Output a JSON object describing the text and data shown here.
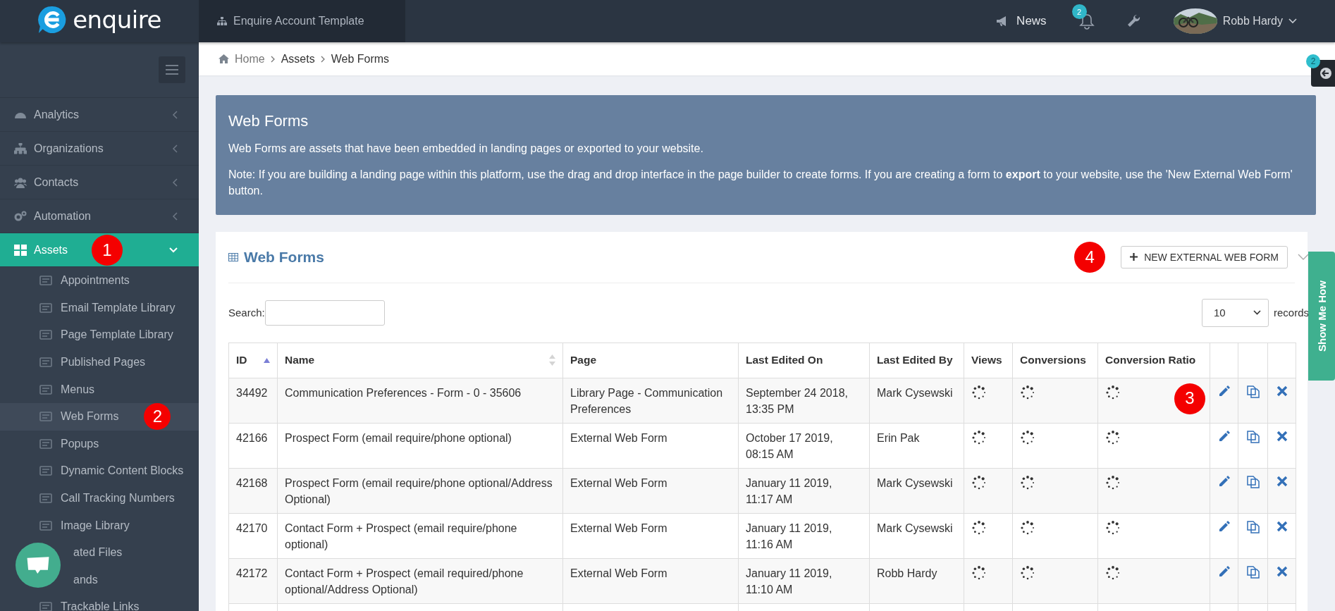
{
  "header": {
    "logo_text": "enquire",
    "account": "Enquire Account Template",
    "news": "News",
    "notifications_count": "2",
    "user": "Robb Hardy"
  },
  "breadcrumb": [
    "Home",
    "Assets",
    "Web Forms"
  ],
  "sidebar": {
    "items": [
      {
        "label": "Analytics",
        "expanded": false,
        "selected": false
      },
      {
        "label": "Organizations",
        "expanded": false,
        "selected": false
      },
      {
        "label": "Contacts",
        "expanded": false,
        "selected": false
      },
      {
        "label": "Automation",
        "expanded": false,
        "selected": false
      },
      {
        "label": "Assets",
        "expanded": true,
        "selected": true,
        "children": [
          {
            "label": "Appointments",
            "selected": false
          },
          {
            "label": "Email Template Library",
            "selected": false
          },
          {
            "label": "Page Template Library",
            "selected": false
          },
          {
            "label": "Published Pages",
            "selected": false
          },
          {
            "label": "Menus",
            "selected": false
          },
          {
            "label": "Web Forms",
            "selected": true
          },
          {
            "label": "Popups",
            "selected": false
          },
          {
            "label": "Dynamic Content Blocks",
            "selected": false
          },
          {
            "label": "Call Tracking Numbers",
            "selected": false
          },
          {
            "label": "Image Library",
            "selected": false
          },
          {
            "label": "ated Files",
            "selected": false
          },
          {
            "label": "ands",
            "selected": false
          },
          {
            "label": "Trackable Links",
            "selected": false
          }
        ]
      }
    ]
  },
  "info": {
    "title": "Web Forms",
    "text": "Web Forms are assets that have been embedded in landing pages or exported to your website.",
    "note": "Note: If you are building a landing page within this platform, use the drag and drop interface in the page builder to create forms. If you are creating a form to **export** to your website, use the 'New External Web Form' button."
  },
  "card": {
    "title": "Web Forms",
    "button": "NEW EXTERNAL WEB FORM",
    "search_label": "Search:",
    "length": "10",
    "length_label": "records"
  },
  "table": {
    "columns": [
      {
        "label": "ID",
        "sorted": true,
        "sortable": true
      },
      {
        "label": "Name",
        "sorted": false,
        "sortable": true
      },
      {
        "label": "Page"
      },
      {
        "label": "Last Edited On"
      },
      {
        "label": "Last Edited By"
      },
      {
        "label": "Views"
      },
      {
        "label": "Conversions"
      },
      {
        "label": "Conversion Ratio"
      }
    ],
    "rows": [
      {
        "id": "34492",
        "name": "Communication Preferences - Form - 0 - 35606",
        "page": "Library Page - Communication Preferences",
        "edited_on": "September 24 2018, 13:35 PM",
        "edited_by": "Mark Cysewski"
      },
      {
        "id": "42166",
        "name": "Prospect Form (email require/phone optional)",
        "page": "External Web Form",
        "edited_on": "October 17 2019, 08:15 AM",
        "edited_by": "Erin Pak"
      },
      {
        "id": "42168",
        "name": "Prospect Form (email require/phone optional/Address Optional)",
        "page": "External Web Form",
        "edited_on": "January 11 2019, 11:17 AM",
        "edited_by": "Mark Cysewski"
      },
      {
        "id": "42170",
        "name": "Contact Form + Prospect (email require/phone optional)",
        "page": "External Web Form",
        "edited_on": "January 11 2019, 11:16 AM",
        "edited_by": "Mark Cysewski"
      },
      {
        "id": "42172",
        "name": "Contact Form + Prospect (email required/phone optional/Address Optional)",
        "page": "External Web Form",
        "edited_on": "January 11 2019, 11:10 AM",
        "edited_by": "Robb Hardy"
      }
    ]
  },
  "side_tab": {
    "badge": "2"
  },
  "help_tab": "Show Me How",
  "annotations": [
    {
      "number": "1"
    },
    {
      "number": "2"
    },
    {
      "number": "3"
    },
    {
      "number": "4"
    }
  ]
}
